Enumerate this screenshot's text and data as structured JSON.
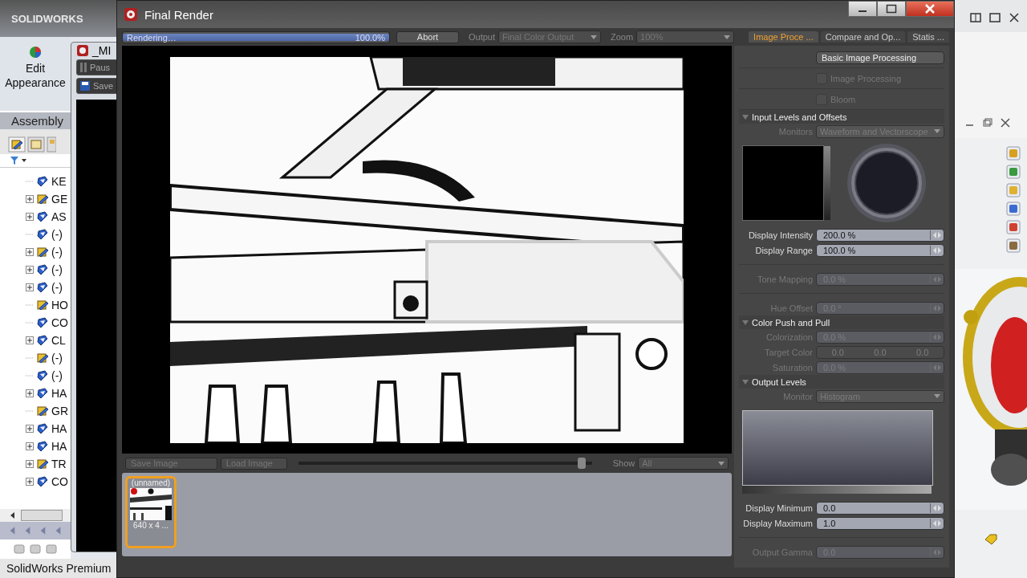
{
  "solidworks": {
    "logo": "SOLIDWORKS",
    "ribbon_button": "Edit Appearance",
    "tab": "Assembly",
    "tree": [
      {
        "label": "KE",
        "collapsed": false
      },
      {
        "label": "GE",
        "collapsed": true
      },
      {
        "label": "AS",
        "collapsed": true
      },
      {
        "label": "(-)",
        "collapsed": false
      },
      {
        "label": "(-)",
        "collapsed": true
      },
      {
        "label": "(-)",
        "collapsed": true
      },
      {
        "label": "(-)",
        "collapsed": true
      },
      {
        "label": "HO",
        "collapsed": false
      },
      {
        "label": "CO",
        "collapsed": false
      },
      {
        "label": "CL",
        "collapsed": true
      },
      {
        "label": "(-)",
        "collapsed": false
      },
      {
        "label": "(-)",
        "collapsed": false
      },
      {
        "label": "HA",
        "collapsed": true
      },
      {
        "label": "GR",
        "collapsed": false
      },
      {
        "label": "HA",
        "collapsed": true
      },
      {
        "label": "HA",
        "collapsed": true
      },
      {
        "label": "TR",
        "collapsed": true
      },
      {
        "label": "CO",
        "collapsed": true
      }
    ],
    "status_bar": "SolidWorks Premium"
  },
  "background_window": {
    "title": "_MI",
    "buttons": [
      "Paus",
      "Save"
    ]
  },
  "render_window": {
    "title": "Final Render",
    "progress": {
      "label": "Rendering…",
      "reading": "100.0%",
      "level": 1
    },
    "abort": "Abort",
    "output": {
      "label": "Output",
      "value": "Final Color Output",
      "disabled": true
    },
    "zoom": {
      "label": "Zoom",
      "value": "100%",
      "disabled": true
    },
    "tabs": [
      {
        "label": "Image Proce ...",
        "selected": true
      },
      {
        "label": "Compare and Op...",
        "selected": false
      },
      {
        "label": "Statis ...",
        "selected": false
      }
    ],
    "bottom_bar": {
      "buttons": [
        {
          "label": "Save Image",
          "disabled": true
        },
        {
          "label": "Load Image",
          "disabled": true
        }
      ],
      "slider": {
        "level": 0.97
      },
      "show": {
        "label": "Show",
        "value": "All",
        "disabled": true
      }
    },
    "thumbnails": [
      {
        "title": "(unnamed)",
        "caption": "640 x 4 ...",
        "selected": true
      }
    ],
    "panel": [
      {
        "kind": "button",
        "label": "Basic Image Processing"
      },
      {
        "kind": "checkbox",
        "label": "Image Processing",
        "checked": false,
        "disabled": true
      },
      {
        "kind": "checkbox",
        "label": "Bloom",
        "checked": false,
        "disabled": true
      },
      {
        "kind": "section",
        "label": "Input Levels and Offsets",
        "expanded": true
      },
      {
        "kind": "dropdown",
        "label": "Monitors",
        "value": "Waveform and Vectorscope",
        "disabled": true
      },
      {
        "kind": "scopes"
      },
      {
        "kind": "field",
        "label": "Display Intensity",
        "value": "200.0 %",
        "disabled": false
      },
      {
        "kind": "field",
        "label": "Display Range",
        "value": "100.0 %",
        "disabled": false
      },
      {
        "kind": "divider"
      },
      {
        "kind": "field",
        "label": "Tone Mapping",
        "value": "0.0 %",
        "disabled": true
      },
      {
        "kind": "divider"
      },
      {
        "kind": "field",
        "label": "Hue Offset",
        "value": "0.0 °",
        "disabled": true
      },
      {
        "kind": "section",
        "label": "Color Push and Pull",
        "expanded": true
      },
      {
        "kind": "field",
        "label": "Colorization",
        "value": "0.0 %",
        "disabled": true
      },
      {
        "kind": "triple",
        "label": "Target Color",
        "values": [
          "0.0",
          "0.0",
          "0.0"
        ],
        "disabled": true
      },
      {
        "kind": "field",
        "label": "Saturation",
        "value": "0.0 %",
        "disabled": true
      },
      {
        "kind": "section",
        "label": "Output Levels",
        "expanded": true
      },
      {
        "kind": "dropdown",
        "label": "Monitor",
        "value": "Histogram",
        "disabled": true
      },
      {
        "kind": "histogram"
      },
      {
        "kind": "field",
        "label": "Display Minimum",
        "value": "0.0",
        "disabled": false
      },
      {
        "kind": "field",
        "label": "Display Maximum",
        "value": "1.0",
        "disabled": false
      },
      {
        "kind": "divider"
      },
      {
        "kind": "field",
        "label": "Output Gamma",
        "value": "0.0",
        "disabled": true
      }
    ]
  }
}
